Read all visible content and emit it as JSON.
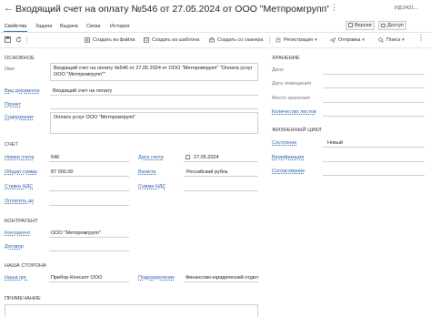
{
  "window": {
    "title": "Входящий счет на оплату №546 от 27.05.2024 от ООО \"Метпромгрупп\" \"Оплата услуг ООО \"Метп",
    "versions_label": "Версии",
    "access_label": "Доступ",
    "id_label": "ИД:",
    "id_value": "2421..."
  },
  "tabs": [
    "Свойства",
    "Задачи",
    "Выдача",
    "Связи",
    "История"
  ],
  "toolbar": {
    "create_from_file": "Создать из файла",
    "create_from_template": "Создать из шаблона",
    "create_from_scanner": "Создать со сканера",
    "registration": "Регистрация",
    "send": "Отправка",
    "search": "Поиск"
  },
  "sections": {
    "main": "Основное",
    "invoice": "Счет",
    "counterparty": "Контрагент",
    "our_side": "Наша сторона",
    "note": "Примечание",
    "storage": "Хранение",
    "lifecycle": "Жизненный цикл"
  },
  "main": {
    "name_label": "Имя",
    "name_value": "Входящий счет на оплату №546 от 27.05.2024 от ООО \"Метпромгрупп\" \"Оплата услуг ООО \"Метпромгрупп\"\"",
    "doc_type_label": "Вид документа",
    "doc_type_value": "Входящий счет на оплату",
    "project_label": "Проект",
    "content_label": "Содержание",
    "content_value": "Оплата услуг ООО \"Метпромгрупп\""
  },
  "invoice": {
    "number_label": "Номер счета",
    "number_value": "546",
    "date_label": "Дата счета",
    "date_value": "27.05.2024",
    "total_label": "Общая сумма",
    "total_value": "87 000.00",
    "currency_label": "Валюта",
    "currency_value": "Российский рубль",
    "vat_rate_label": "Ставка НДС",
    "vat_sum_label": "Сумма НДС",
    "pay_until_label": "Оплатить до"
  },
  "counterparty": {
    "counterparty_label": "Контрагент",
    "counterparty_value": "ООО \"Метпромгрупп\"",
    "contract_label": "Договор"
  },
  "our_side": {
    "org_label": "Наша орг.",
    "org_value": "Прибор-Консалт ООО",
    "dept_label": "Подразделение",
    "dept_value": "Финансово-юридический отдел"
  },
  "storage": {
    "case_label": "Дело",
    "placement_date_label": "Дата помещения",
    "storage_place_label": "Место хранения",
    "sheets_label": "Количество листов"
  },
  "lifecycle": {
    "state_label": "Состояние",
    "state_value": "Новый",
    "verification_label": "Верификация",
    "approval_label": "Согласование"
  },
  "colors": {
    "link": "#2b62a6",
    "tab_accent": "#2e6da4",
    "border": "#cfcfcf"
  }
}
